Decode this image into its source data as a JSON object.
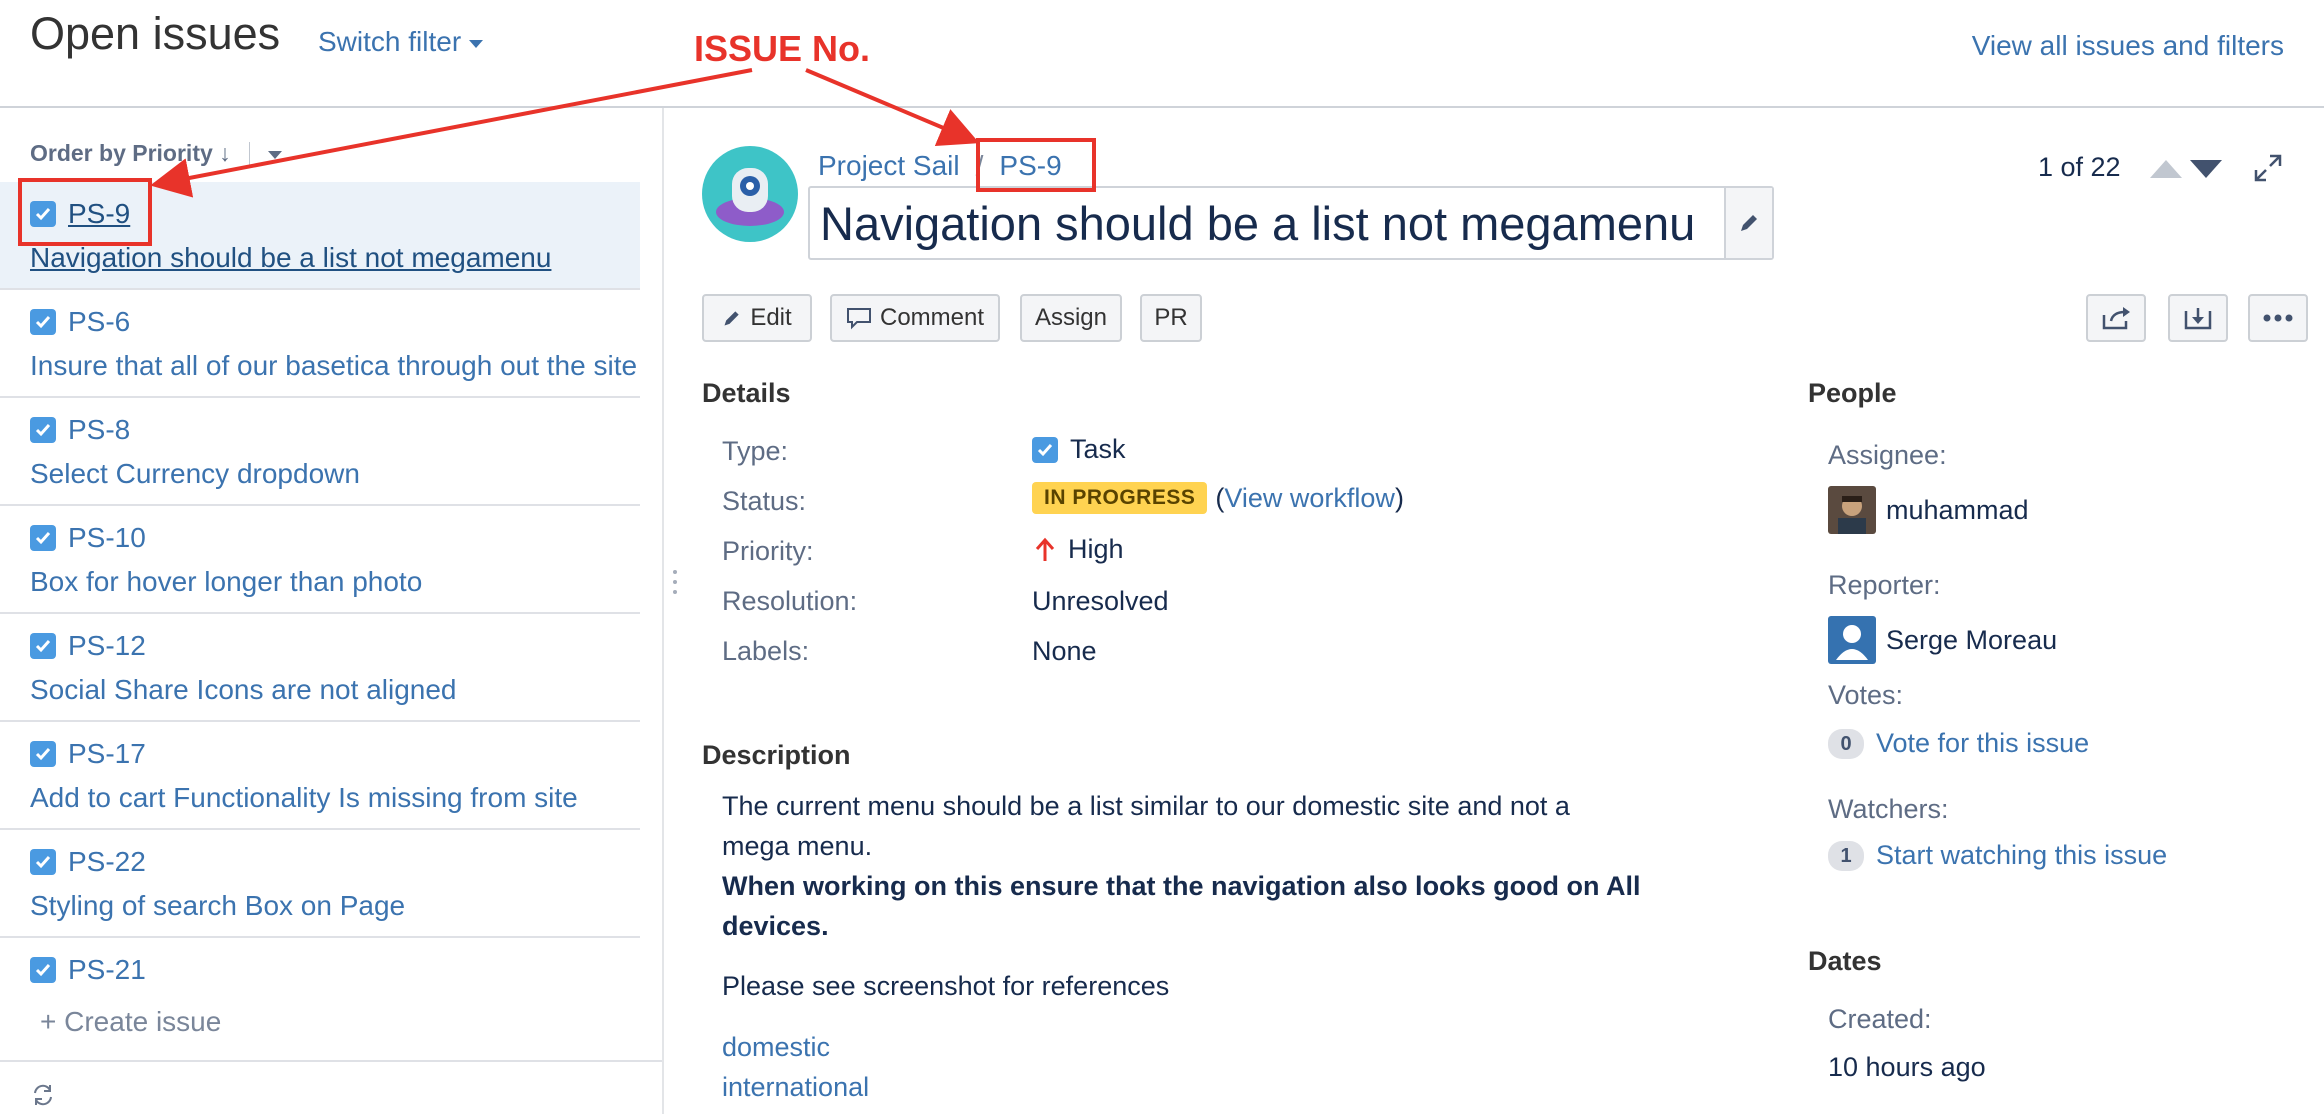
{
  "header": {
    "title": "Open issues",
    "switch_filter": "Switch filter",
    "view_all": "View all issues and filters"
  },
  "annotation": {
    "text": "ISSUE No.",
    "color": "#e8332a"
  },
  "sidebar": {
    "order_by": "Order by Priority",
    "order_arrow": "↓",
    "issues": [
      {
        "key": "PS-9",
        "summary": "Navigation should be a list not megamenu",
        "selected": true
      },
      {
        "key": "PS-6",
        "summary": "Insure that all of our basetica through out the site"
      },
      {
        "key": "PS-8",
        "summary": "Select Currency dropdown"
      },
      {
        "key": "PS-10",
        "summary": "Box for hover longer than photo"
      },
      {
        "key": "PS-12",
        "summary": "Social Share Icons are not aligned"
      },
      {
        "key": "PS-17",
        "summary": "Add to cart Functionality Is missing from site"
      },
      {
        "key": "PS-22",
        "summary": "Styling of search Box on Page"
      },
      {
        "key": "PS-21",
        "summary": ""
      }
    ],
    "create_issue": "+ Create issue"
  },
  "issue": {
    "project": "Project Sail",
    "separator": "/",
    "key": "PS-9",
    "summary": "Navigation should be a list not megamenu",
    "pager": "1 of 22"
  },
  "toolbar": {
    "edit": "Edit",
    "comment": "Comment",
    "assign": "Assign",
    "pr": "PR"
  },
  "details": {
    "heading": "Details",
    "type_label": "Type:",
    "type_value": "Task",
    "status_label": "Status:",
    "status_value": "IN PROGRESS",
    "view_workflow_open": "(",
    "view_workflow": "View workflow",
    "view_workflow_close": ")",
    "priority_label": "Priority:",
    "priority_value": "High",
    "resolution_label": "Resolution:",
    "resolution_value": "Unresolved",
    "labels_label": "Labels:",
    "labels_value": "None"
  },
  "description": {
    "heading": "Description",
    "line1": "The current menu should be a list similar to our domestic site and not a",
    "line2": "mega menu.",
    "bold1": "When working on this ensure that the navigation also looks good on All",
    "bold2": "devices.",
    "line3": "Please see screenshot for references",
    "link1": "domestic",
    "link2": "international"
  },
  "people": {
    "heading": "People",
    "assignee_label": "Assignee:",
    "assignee": "muhammad",
    "reporter_label": "Reporter:",
    "reporter": "Serge Moreau",
    "votes_label": "Votes:",
    "votes_count": "0",
    "vote_link": "Vote for this issue",
    "watchers_label": "Watchers:",
    "watchers_count": "1",
    "watch_link": "Start watching this issue"
  },
  "dates": {
    "heading": "Dates",
    "created_label": "Created:",
    "created_value": "10 hours ago"
  },
  "colors": {
    "link": "#3b73af",
    "status": "#ffd351",
    "task_icon": "#4a9ae1",
    "priority_high": "#e8332a"
  }
}
